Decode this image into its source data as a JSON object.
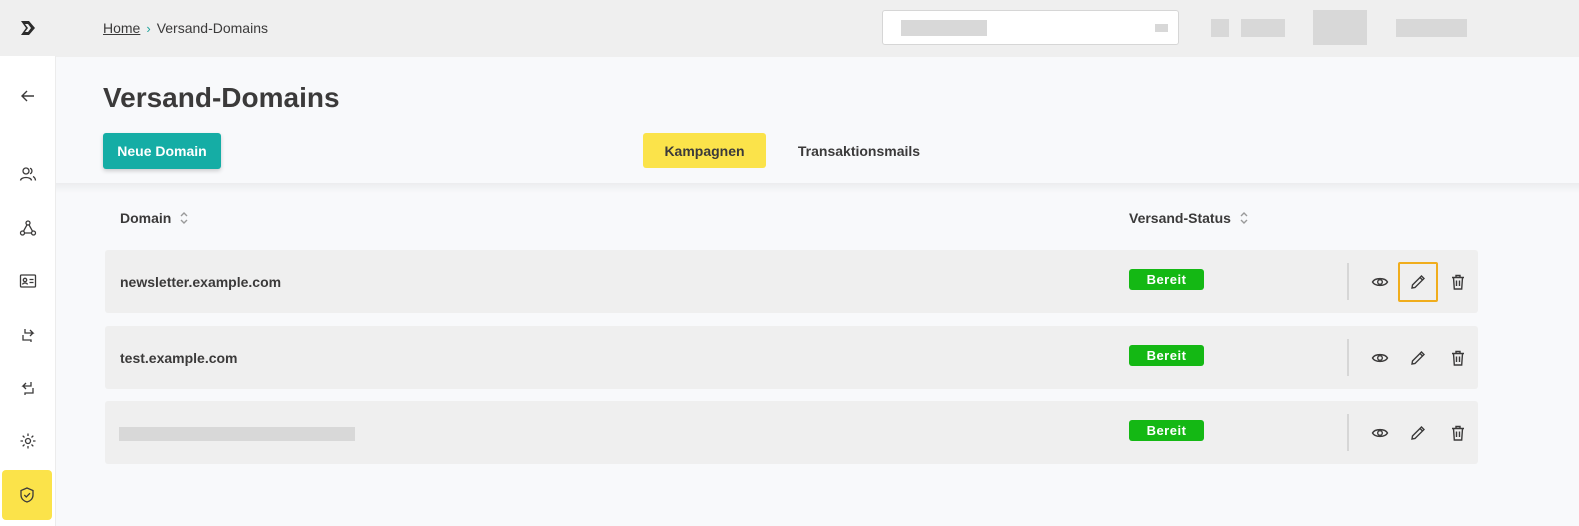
{
  "breadcrumb": {
    "home": "Home",
    "separator": "›",
    "current": "Versand-Domains"
  },
  "page": {
    "title": "Versand-Domains",
    "new_button": "Neue Domain"
  },
  "tabs": [
    {
      "label": "Kampagnen",
      "active": true
    },
    {
      "label": "Transaktionsmails",
      "active": false
    }
  ],
  "table": {
    "columns": [
      "Domain",
      "Versand-Status"
    ],
    "rows": [
      {
        "domain": "newsletter.example.com",
        "status": "Bereit"
      },
      {
        "domain": "test.example.com",
        "status": "Bereit"
      },
      {
        "domain": "",
        "status": "Bereit",
        "domain_redacted": true
      }
    ]
  },
  "sidebar_icons": [
    "logo-icon",
    "back-arrow-icon",
    "users-icon",
    "network-icon",
    "contact-card-icon",
    "import-icon",
    "export-icon",
    "settings-gear-icon",
    "shield-check-icon"
  ],
  "colors": {
    "accent": "#15ada5",
    "highlight": "#fbe34a",
    "status_ready": "#14b814",
    "focus_outline": "#f0ad1d"
  }
}
